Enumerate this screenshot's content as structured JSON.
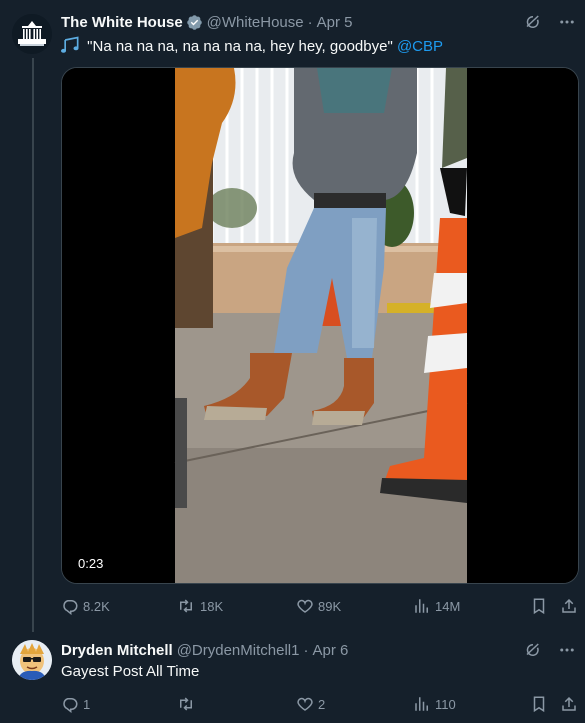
{
  "posts": [
    {
      "author": "The White House",
      "handle": "@WhiteHouse",
      "separator": "·",
      "date": "Apr 5",
      "text": "\"Na na na na, na na na na, hey hey, goodbye\"",
      "mention": "@CBP",
      "media": {
        "duration": "0:23"
      },
      "stats": {
        "replies": "8.2K",
        "reposts": "18K",
        "likes": "89K",
        "views": "14M"
      }
    },
    {
      "author": "Dryden Mitchell",
      "handle": "@DrydenMitchell1",
      "separator": "·",
      "date": "Apr 6",
      "text": "Gayest Post All Time",
      "stats": {
        "replies": "1",
        "reposts": "",
        "likes": "2",
        "views": "110"
      }
    }
  ],
  "colors": {
    "background": "#15202b",
    "text": "#f7f9f9",
    "secondary": "#8b98a5",
    "accent": "#1d9bf0",
    "divider": "#38444d"
  },
  "icons": [
    "verified-badge-icon",
    "grok-icon",
    "more-icon",
    "music-note-icon",
    "reply-icon",
    "repost-icon",
    "like-icon",
    "views-icon",
    "bookmark-icon",
    "share-icon"
  ]
}
